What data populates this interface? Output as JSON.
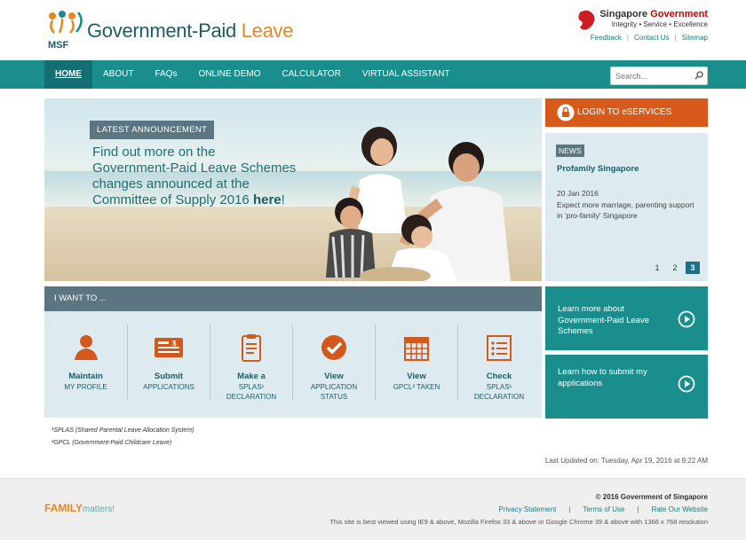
{
  "header": {
    "logo_text": "MSF",
    "brand_main": "Government-Paid",
    "brand_accent": "Leave",
    "gov_name_1": "Singapore",
    "gov_name_2": "Government",
    "gov_tagline": "Integrity • Service • Excellence",
    "links": [
      "Feedback",
      "Contact Us",
      "Sitemap"
    ]
  },
  "nav": {
    "items": [
      "HOME",
      "ABOUT",
      "FAQs",
      "ONLINE DEMO",
      "CALCULATOR",
      "VIRTUAL ASSISTANT"
    ],
    "active": "HOME"
  },
  "search": {
    "placeholder": "Search..."
  },
  "hero": {
    "label": "LATEST ANNOUNCEMENT",
    "text": "Find out more on the Government-Paid Leave Schemes changes announced at the Committee of Supply 2016 ",
    "link": "here",
    "suffix": "!"
  },
  "login": {
    "label": "LOGIN TO eSERVICES"
  },
  "news": {
    "tag": "NEWS",
    "title": "Profamily Singapore",
    "date": "20 Jan 2016",
    "desc": "Expect more marriage, parenting support in 'pro-family' Singapore",
    "pages": [
      "1",
      "2",
      "3"
    ],
    "current_page": "3"
  },
  "iwant": {
    "title": "I WANT TO ...",
    "tiles": [
      {
        "bold": "Maintain",
        "sub": "MY PROFILE",
        "icon": "user-icon"
      },
      {
        "bold": "Submit",
        "sub": "APPLICATIONS",
        "icon": "form-icon"
      },
      {
        "bold": "Make a",
        "sub": "SPLAS¹",
        "sub2": "DECLARATION",
        "icon": "clipboard-icon"
      },
      {
        "bold": "View",
        "sub": "APPLICATION",
        "sub2": "STATUS",
        "icon": "check-circle-icon"
      },
      {
        "bold": "View",
        "sub": "GPCL² TAKEN",
        "icon": "calendar-icon"
      },
      {
        "bold": "Check",
        "sub": "SPLAS¹",
        "sub2": "DECLARATION",
        "icon": "list-icon"
      }
    ]
  },
  "promos": [
    {
      "text": "Learn more about Government-Paid Leave Schemes"
    },
    {
      "text": "Learn how to submit my applications"
    }
  ],
  "footnotes": {
    "f1": "¹SPLAS (Shared Parental Leave Allocation System)",
    "f2": "²GPCL (Government-Paid Childcare Leave)"
  },
  "updated": "Last Updated on: Tuesday, Apr 19, 2016 at 9:22 AM",
  "footer": {
    "family_main": "FAMILY",
    "family_small": "matters!",
    "copyright": "© 2016 Government of Singapore",
    "links": [
      "Privacy Statement",
      "Terms of Use",
      "Rate Our Website"
    ],
    "best_viewed": "This site is best viewed using IE9 & above, Mozilla Firefox 33 & above or Google Chrome 39 & above with 1366 x 768 resolution"
  },
  "colors": {
    "teal": "#1a8d8d",
    "orange": "#d85a1a",
    "slate": "#5b7680",
    "light_blue": "#ddeaf0"
  }
}
